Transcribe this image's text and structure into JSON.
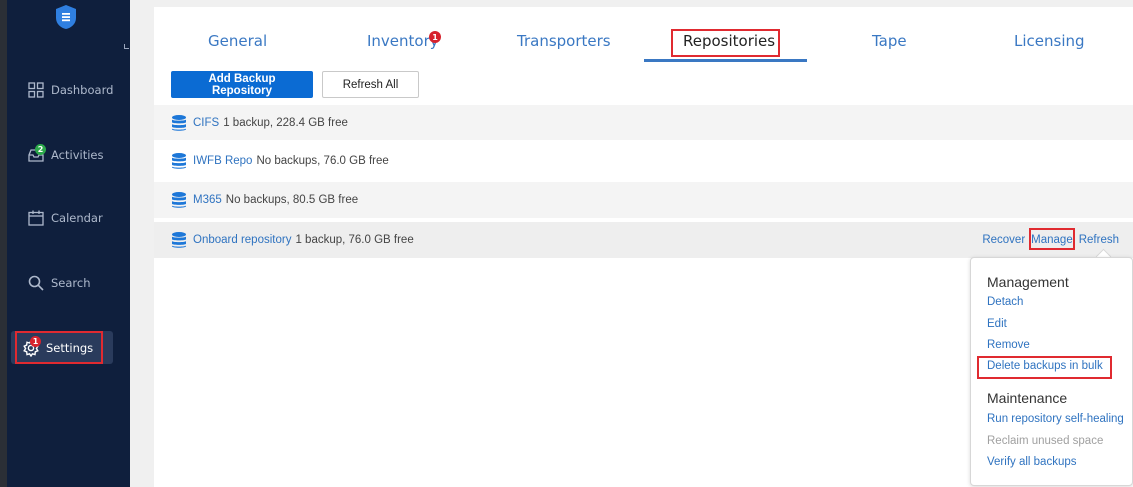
{
  "sidebar": {
    "items": [
      {
        "label": "Dashboard",
        "icon": "grid-icon"
      },
      {
        "label": "Activities",
        "icon": "inbox-icon",
        "badge": "2"
      },
      {
        "label": "Calendar",
        "icon": "calendar-icon"
      },
      {
        "label": "Search",
        "icon": "search-icon"
      },
      {
        "label": "Settings",
        "icon": "gear-icon",
        "badge": "1"
      }
    ]
  },
  "tabs": [
    {
      "label": "General"
    },
    {
      "label": "Inventory",
      "badge": "1"
    },
    {
      "label": "Transporters"
    },
    {
      "label": "Repositories",
      "active": true
    },
    {
      "label": "Tape"
    },
    {
      "label": "Licensing"
    }
  ],
  "toolbar": {
    "add_label": "Add Backup Repository",
    "refresh_label": "Refresh All"
  },
  "repositories": [
    {
      "name": "CIFS",
      "info": "1 backup, 228.4 GB free"
    },
    {
      "name": "IWFB Repo",
      "info": "No backups, 76.0 GB free"
    },
    {
      "name": "M365",
      "info": "No backups, 80.5 GB free"
    },
    {
      "name": "Onboard repository",
      "info": "1 backup, 76.0 GB free"
    }
  ],
  "row_actions": {
    "recover": "Recover",
    "manage": "Manage",
    "refresh": "Refresh"
  },
  "menu": {
    "management_header": "Management",
    "detach": "Detach",
    "edit": "Edit",
    "remove": "Remove",
    "delete_bulk": "Delete backups in bulk",
    "maintenance_header": "Maintenance",
    "self_heal": "Run repository self-healing",
    "reclaim": "Reclaim unused space",
    "verify": "Verify all backups"
  },
  "colors": {
    "sidebar_bg": "#0f1f3d",
    "accent": "#0b6bd3",
    "link": "#2f73c0",
    "highlight_box": "#e02a30"
  }
}
